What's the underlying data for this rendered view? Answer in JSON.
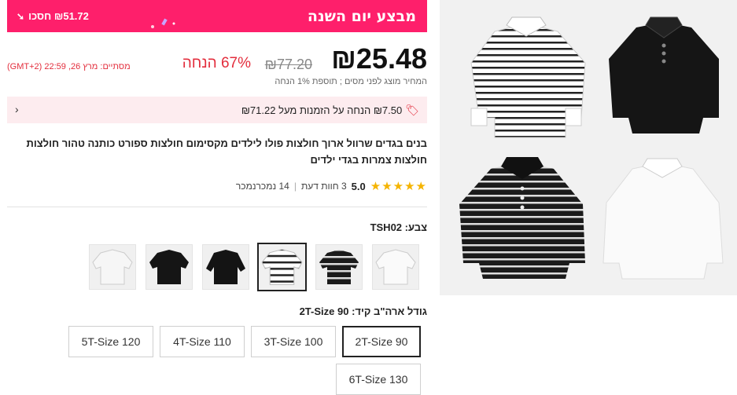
{
  "promo": {
    "title": "מבצע יום השנה",
    "save_text": "₪51.72 חסכו",
    "bg_color": "#fe1f6b"
  },
  "price": {
    "current": "₪25.48",
    "original": "₪77.20",
    "discount": "67% הנחה",
    "ends_text": "מסתיים: מרץ 26, 22:59 (GMT+2)",
    "tax_note": "המחיר מוצג לפני מסים ; תוספת 1% הנחה",
    "accent_color": "#e32d3c"
  },
  "coupon": {
    "text": "₪7.50 הנחה על הזמנות מעל ₪71.22",
    "icon": "tag-icon"
  },
  "product": {
    "title": "בנים בגדים שרוול ארוך חולצות פולו לילדים מקסימום חולצות ספורט כותנה טהור חולצות חולצות צמרות בגדי ילדים"
  },
  "rating": {
    "stars": "★★★★★",
    "value": "5.0",
    "reviews": "3 חוות דעת",
    "recommenders": "14 נמכרנמכר"
  },
  "color": {
    "label": "צבע:",
    "value": "TSH02",
    "swatches": [
      "white-polo",
      "striped-polo-alt",
      "striped-polo-selected",
      "black-longsleeve",
      "black-shortsleeve",
      "white-shortsleeve"
    ]
  },
  "size": {
    "label": "גודל ארה\"ב קיד:",
    "value": "2T-Size 90",
    "options": [
      "2T-Size 90",
      "3T-Size 100",
      "4T-Size 110",
      "5T-Size 120",
      "6T-Size 130"
    ]
  }
}
